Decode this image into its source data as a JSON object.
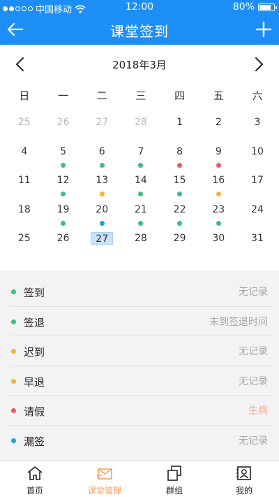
{
  "status_bar": {
    "carrier": "中国移动",
    "time": "12:00",
    "battery": "80%",
    "battery_level": 0.8
  },
  "header": {
    "title": "课堂签到",
    "back_icon": "back-arrow-icon",
    "add_icon": "plus-icon"
  },
  "calendar": {
    "month_label": "2018年3月",
    "weekdays": [
      "日",
      "一",
      "二",
      "三",
      "四",
      "五",
      "六"
    ],
    "days": [
      {
        "n": "25",
        "muted": true
      },
      {
        "n": "26",
        "muted": true
      },
      {
        "n": "27",
        "muted": true
      },
      {
        "n": "28",
        "muted": true
      },
      {
        "n": "1"
      },
      {
        "n": "2"
      },
      {
        "n": "3"
      },
      {
        "n": "4"
      },
      {
        "n": "5",
        "status": "signin"
      },
      {
        "n": "6",
        "status": "signin"
      },
      {
        "n": "7",
        "status": "signin"
      },
      {
        "n": "8",
        "status": "leave"
      },
      {
        "n": "9",
        "status": "leave"
      },
      {
        "n": "10"
      },
      {
        "n": "11"
      },
      {
        "n": "12",
        "status": "signin"
      },
      {
        "n": "13",
        "status": "late"
      },
      {
        "n": "14",
        "status": "signin"
      },
      {
        "n": "15",
        "status": "signin"
      },
      {
        "n": "16",
        "status": "late"
      },
      {
        "n": "17"
      },
      {
        "n": "18"
      },
      {
        "n": "19",
        "status": "signin"
      },
      {
        "n": "20",
        "status": "missed"
      },
      {
        "n": "21",
        "status": "signin"
      },
      {
        "n": "22",
        "status": "signin"
      },
      {
        "n": "23",
        "status": "signin"
      },
      {
        "n": "24"
      },
      {
        "n": "25"
      },
      {
        "n": "26"
      },
      {
        "n": "27",
        "today": true
      },
      {
        "n": "28"
      },
      {
        "n": "29"
      },
      {
        "n": "30"
      },
      {
        "n": "31"
      }
    ]
  },
  "status_colors": {
    "signin": "#3dbd86",
    "signout": "#3dbd86",
    "late": "#f0b43a",
    "early": "#f0b43a",
    "leave": "#ec5a66",
    "missed": "#1aa3e0"
  },
  "legend": [
    {
      "key": "signin",
      "label": "签到",
      "value": "无记录"
    },
    {
      "key": "signout",
      "label": "签退",
      "value": "未到签退时间"
    },
    {
      "key": "late",
      "label": "迟到",
      "value": "无记录"
    },
    {
      "key": "early",
      "label": "早退",
      "value": "无记录"
    },
    {
      "key": "leave",
      "label": "请假",
      "value": "生病",
      "value_color": "#f2a79a"
    },
    {
      "key": "missed",
      "label": "漏签",
      "value": "无记录"
    }
  ],
  "tabs": [
    {
      "label": "首页",
      "icon": "home-icon"
    },
    {
      "label": "课堂管理",
      "icon": "envelope-icon",
      "active": true
    },
    {
      "label": "群组",
      "icon": "group-squares-icon"
    },
    {
      "label": "我的",
      "icon": "profile-card-icon"
    }
  ],
  "colors": {
    "header": "#1d8ef5",
    "active_tab": "#f2a25f"
  }
}
